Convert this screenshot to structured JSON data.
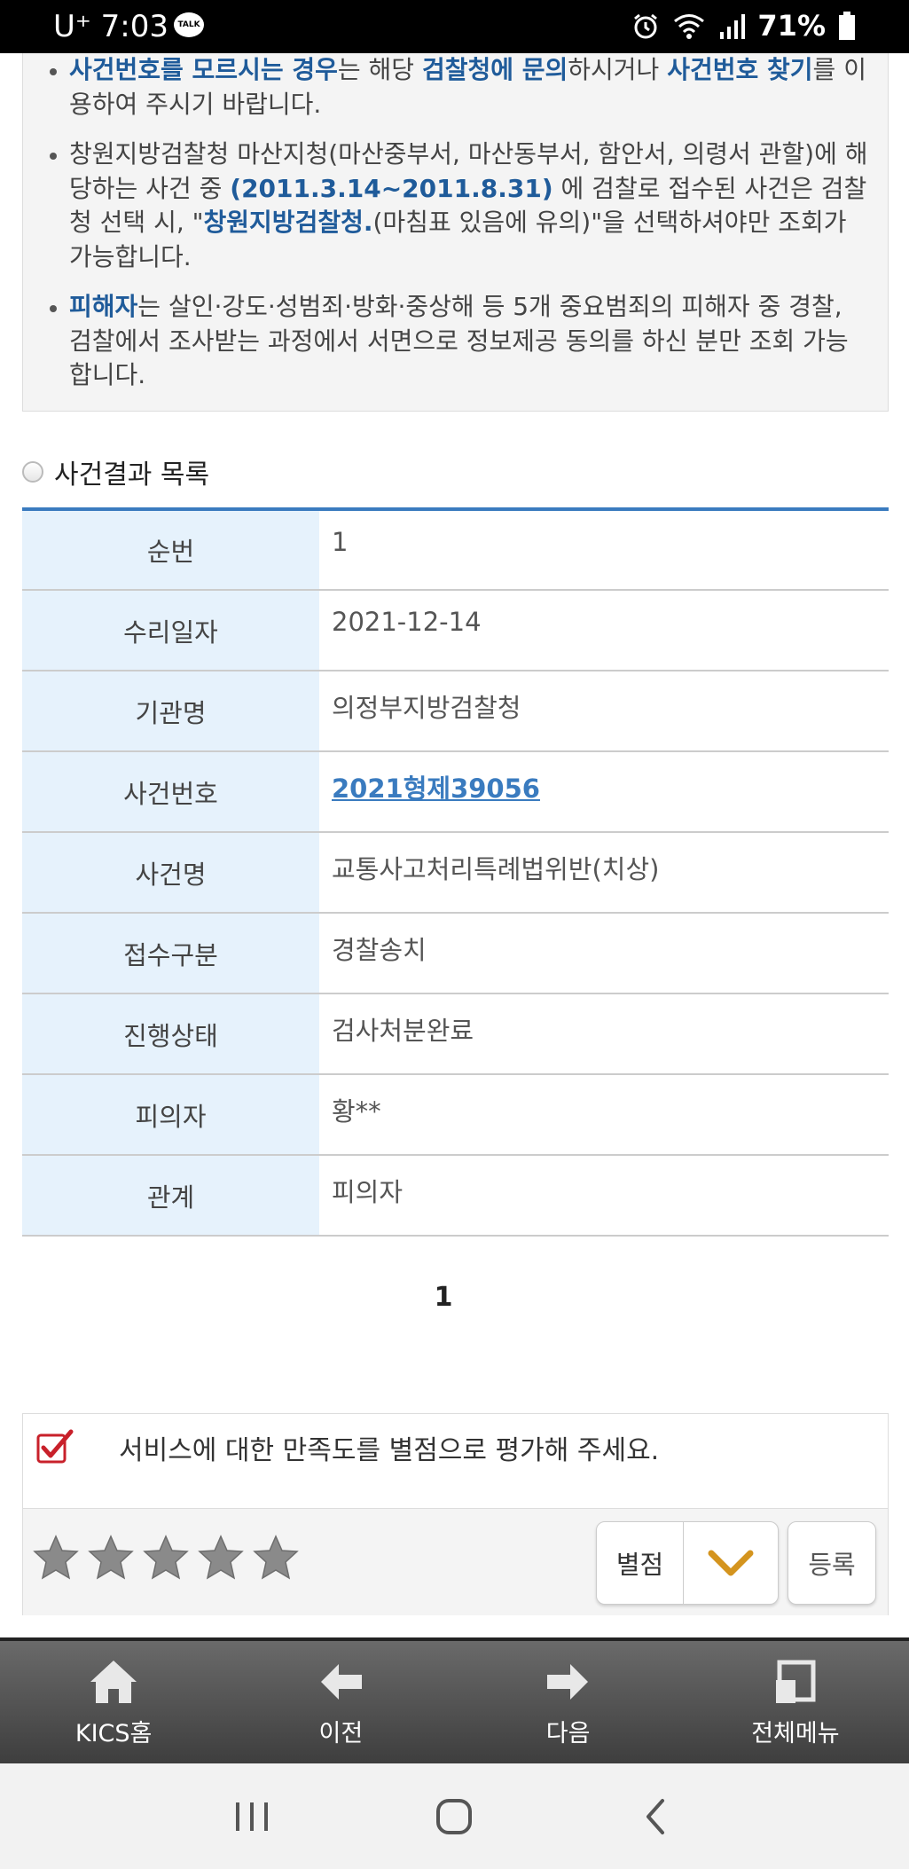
{
  "status_bar": {
    "carrier_time": "U⁺ 7:03",
    "talk_badge": "TALK",
    "battery": "71%"
  },
  "notice": {
    "item1_bold1": "사건번호를 모르시는 경우",
    "item1_text1": "는 해당 ",
    "item1_bold2": "검찰청에 문의",
    "item1_text2": "하시거나 ",
    "item1_bold3": "사건번호 찾기",
    "item1_text3": "를 이용하여 주시기 바랍니다.",
    "item2_text1": "창원지방검찰청 마산지청(마산중부서, 마산동부서, 함안서, 의령서 관할)에 해당하는 사건 중 ",
    "item2_bold1": "(2011.3.14~2011.8.31)",
    "item2_text2": " 에 검찰로 접수된 사건은 검찰청 선택 시, \"",
    "item2_bold2": "창원지방검찰청.",
    "item2_text3": "(마침표 있음에 유의)\"을 선택하셔야만 조회가 가능합니다.",
    "item3_bold1": "피해자",
    "item3_text1": "는 살인·강도·성범죄·방화·중상해 등 5개 중요범죄의 피해자 중 경찰, 검찰에서 조사받는 과정에서 서면으로 정보제공 동의를 하신 분만 조회 가능합니다."
  },
  "section_title": "사건결과 목록",
  "result_table": {
    "rows": [
      {
        "label": "순번",
        "value": "1"
      },
      {
        "label": "수리일자",
        "value": "2021-12-14"
      },
      {
        "label": "기관명",
        "value": "의정부지방검찰청"
      },
      {
        "label": "사건번호",
        "value": "2021형제39056"
      },
      {
        "label": "사건명",
        "value": "교통사고처리특례법위반(치상)"
      },
      {
        "label": "접수구분",
        "value": "경찰송치"
      },
      {
        "label": "진행상태",
        "value": "검사처분완료"
      },
      {
        "label": "피의자",
        "value": "황**"
      },
      {
        "label": "관계",
        "value": "피의자"
      }
    ]
  },
  "pager": {
    "current": "1"
  },
  "rating": {
    "question": "서비스에 대한 만족도를 별점으로 평가해 주세요.",
    "stars_selected": 0,
    "stars_total": 5,
    "score_label": "별점",
    "register_label": "등록"
  },
  "app_nav": {
    "home": "KICS홈",
    "prev": "이전",
    "next": "다음",
    "menu": "전체메뉴"
  },
  "colors": {
    "accent": "#3a7bbf",
    "highlight_text": "#1f5b9a",
    "header_cell_bg": "#e6f2fc",
    "check_red": "#c8202a",
    "chevron_orange": "#d4941e"
  }
}
